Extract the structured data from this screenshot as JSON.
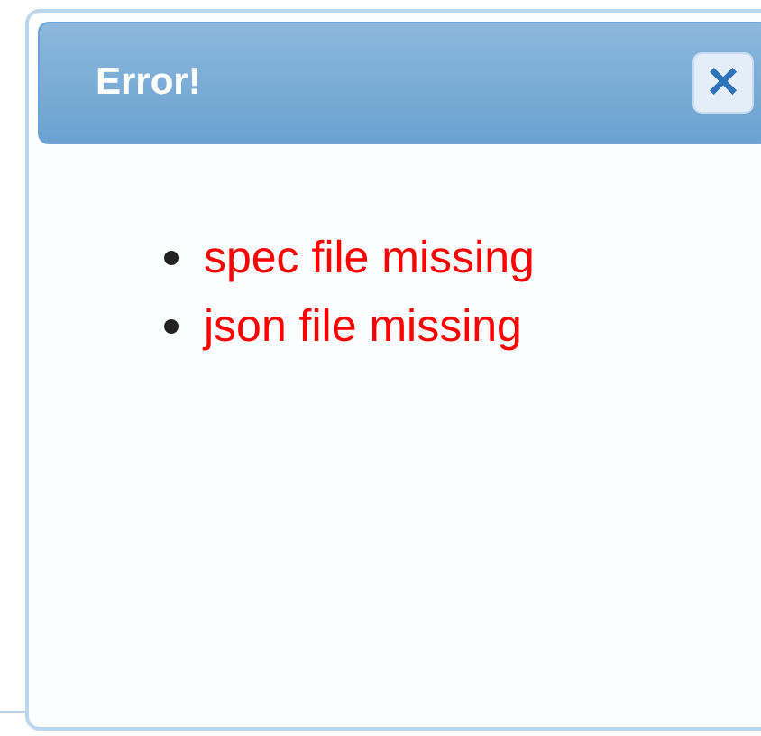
{
  "dialog": {
    "title": "Error!",
    "close_label": "×",
    "messages": [
      "spec file missing",
      "json file missing"
    ]
  }
}
